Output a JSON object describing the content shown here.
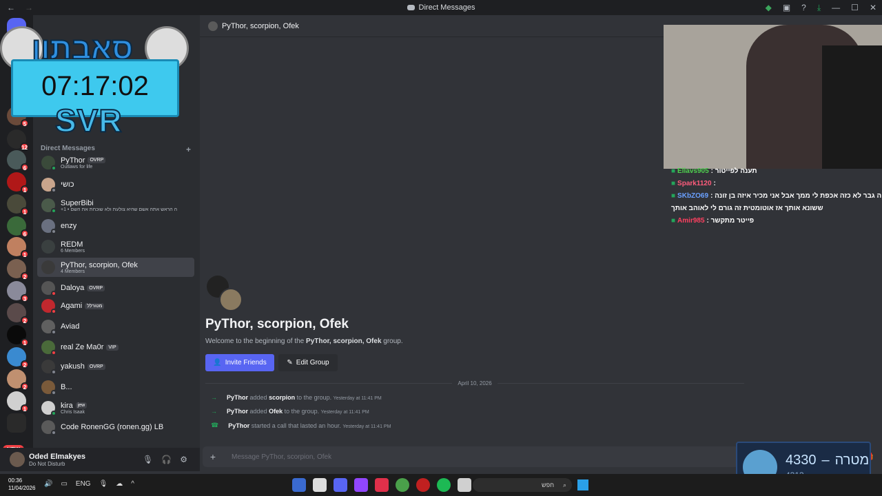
{
  "window": {
    "title": "Direct Messages"
  },
  "overlay": {
    "heb_title": "סאבתון",
    "timer": "07:17:02",
    "svr_text": "SVR"
  },
  "servers": {
    "badges": [
      "5",
      "12",
      "6",
      "1",
      "1",
      "6",
      "1",
      "2",
      "3",
      "2",
      "1",
      "2",
      "2",
      "1",
      "1"
    ],
    "new_label": "NEW"
  },
  "sidebar": {
    "dm_header": "Direct Messages",
    "dms": [
      {
        "name": "PyThor",
        "tag": "OVRP",
        "sub": "Outlaws for life",
        "color": "#3a4a3a",
        "status": "#23a55a"
      },
      {
        "name": "כושי",
        "tag": "",
        "sub": "",
        "color": "#c9a58c",
        "status": "#80848e"
      },
      {
        "name": "SuperBibi",
        "tag": "",
        "sub": "+1 • ה הראש אתה אשם שהיא צולעת ולא שוכחת את השם",
        "color": "#4a5a4a",
        "status": "#23a55a"
      },
      {
        "name": "enzy",
        "tag": "",
        "sub": "",
        "color": "#6a7080",
        "status": "#80848e"
      },
      {
        "name": "REDM",
        "tag": "",
        "sub": "6 Members",
        "color": "#3a4040",
        "status": ""
      },
      {
        "name": "PyThor, scorpion, Ofek",
        "tag": "",
        "sub": "4 Members",
        "color": "#3a3a3a",
        "status": ""
      },
      {
        "name": "Daloya",
        "tag": "OVRP",
        "sub": "",
        "color": "#555",
        "status": "#f23f43"
      },
      {
        "name": "Agami",
        "tag": "מטורלל",
        "sub": "",
        "color": "#c0282e",
        "status": "#f23f43"
      },
      {
        "name": "Aviad",
        "tag": "",
        "sub": "",
        "color": "#606060",
        "status": "#80848e"
      },
      {
        "name": "real Ze Ma0r",
        "tag": "VIP",
        "sub": "",
        "color": "#4a6a3a",
        "status": "#f23f43"
      },
      {
        "name": "yakush",
        "tag": "OVRP",
        "sub": "",
        "color": "#3a3a3a",
        "status": "#80848e"
      },
      {
        "name": "B...",
        "tag": "",
        "sub": "",
        "color": "#7a5a3a",
        "status": "#80848e"
      },
      {
        "name": "kira",
        "tag": "jew",
        "sub": "Chris Isaak",
        "color": "#d0d0d0",
        "status": "#23a55a"
      },
      {
        "name": "Code RonenGG (ronen.gg) LB",
        "tag": "",
        "sub": "",
        "color": "#5a5a5a",
        "status": "#80848e"
      }
    ]
  },
  "user": {
    "name": "Oded Elmakyes",
    "status": "Do Not Disturb"
  },
  "channel": {
    "name": "PyThor, scorpion, Ofek",
    "big_title": "PyThor, scorpion, Ofek",
    "welcome_prefix": "Welcome to the beginning of the",
    "welcome_group": "PyThor, scorpion, Ofek",
    "welcome_suffix": "group.",
    "invite_label": "Invite Friends",
    "edit_label": "Edit Group",
    "date": "April 10, 2026",
    "messages": [
      {
        "actor": "PyThor",
        "verb": "added",
        "target": "scorpion",
        "rest": "to the group.",
        "time": "Yesterday at 11:41 PM"
      },
      {
        "actor": "PyThor",
        "verb": "added",
        "target": "Ofek",
        "rest": "to the group.",
        "time": "Yesterday at 11:41 PM"
      },
      {
        "actor": "PyThor",
        "verb": "started a call that lasted an hour.",
        "target": "",
        "rest": "",
        "time": "Yesterday at 11:41 PM"
      }
    ],
    "composer_placeholder": "Message PyThor, scorpion, Ofek"
  },
  "stream_chat": [
    {
      "user": "Ellavs905",
      "text": "תענה לפייטור :",
      "color": "#4fd14f"
    },
    {
      "user": "Spark1120",
      "text": ":",
      "color": "#ff5c7c"
    },
    {
      "user": "SKbZO69",
      "text": "ה גבר לא כזה אכפת לי ממך אבל אני מכיר איזה בן זונה :",
      "color": "#6aa0ff"
    },
    {
      "user": "",
      "text": "ששונא אותך אז אוטומטית זה גורם לי לאוהב אותך",
      "color": ""
    },
    {
      "user": "Amir985",
      "text": "פייטר מתקשר :",
      "color": "#ff4060"
    }
  ],
  "goal": {
    "current": "4330",
    "label": "מטרה",
    "dash": "–",
    "target": "4313"
  },
  "taskbar": {
    "time": "00:36",
    "date": "11/04/2026",
    "lang": "ENG",
    "search": "חפש"
  }
}
